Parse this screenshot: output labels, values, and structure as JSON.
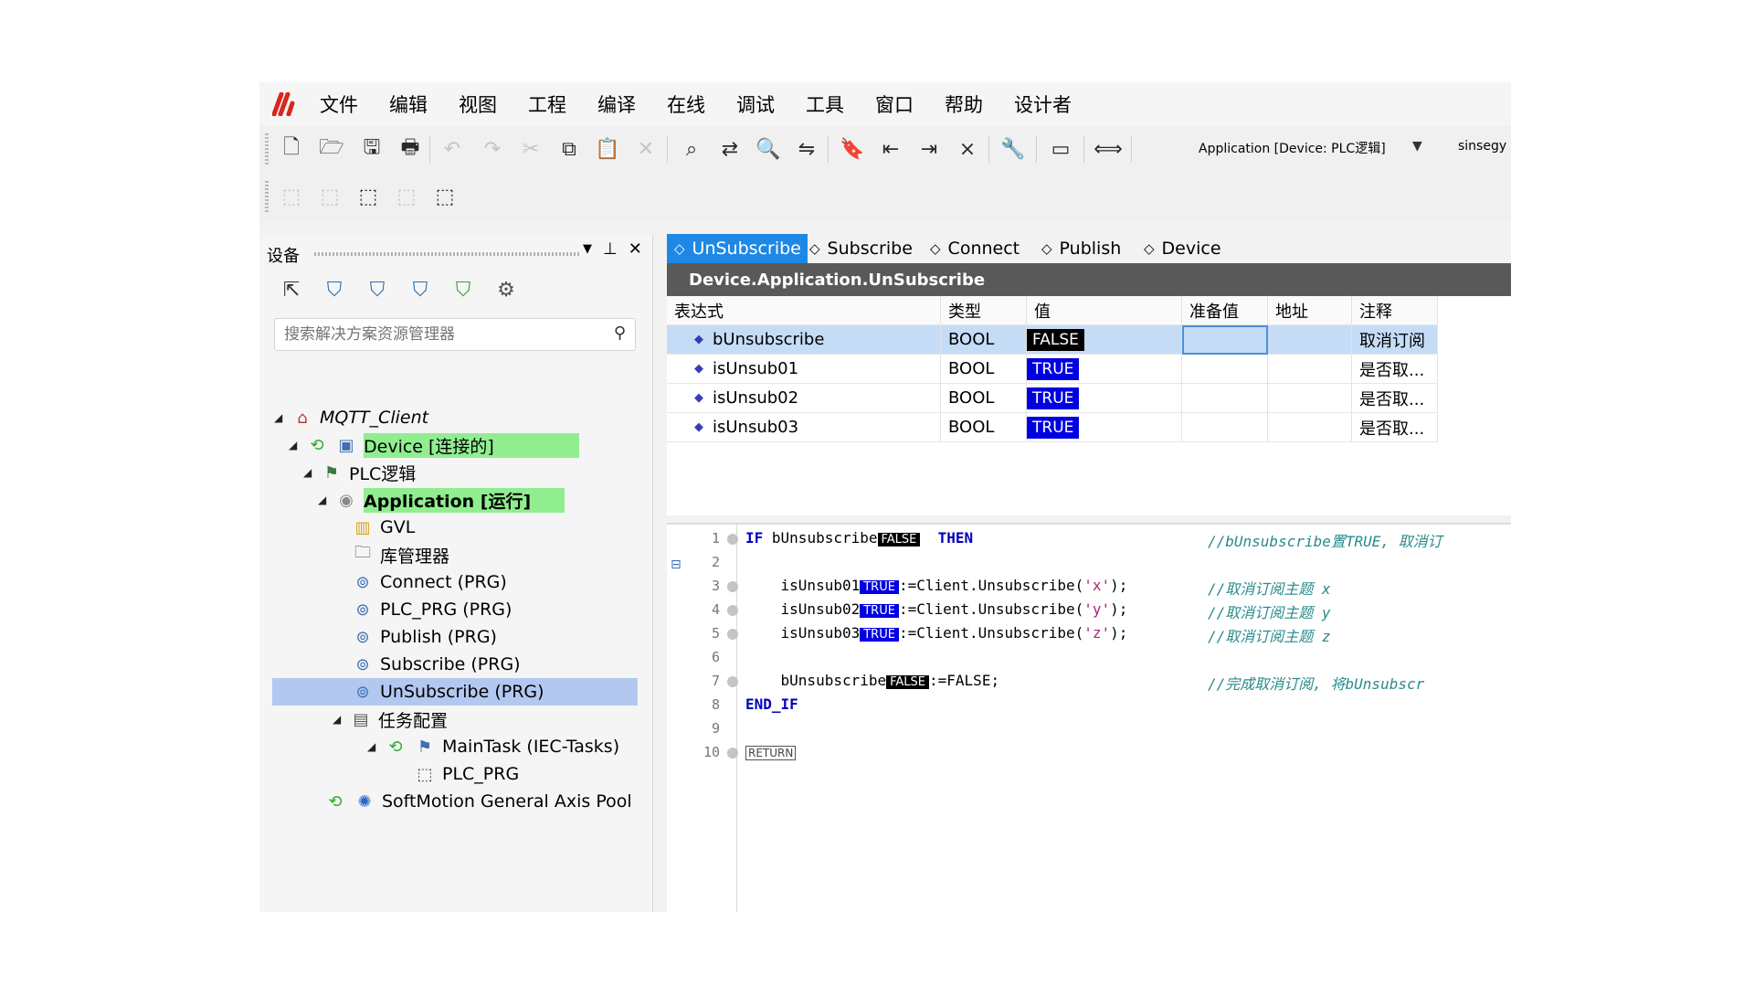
{
  "menu": [
    "文件",
    "编辑",
    "视图",
    "工程",
    "编译",
    "在线",
    "调试",
    "工具",
    "窗口",
    "帮助",
    "设计者"
  ],
  "toolbar": {
    "active_app": "Application [Device: PLC逻辑]",
    "user": "sinsegy"
  },
  "devices_panel": {
    "title": "设备",
    "search_placeholder": "搜索解决方案资源管理器",
    "tree": [
      {
        "label": "MQTT_Client"
      },
      {
        "label": "Device [连接的]"
      },
      {
        "label": "PLC逻辑"
      },
      {
        "label": "Application [运行]"
      },
      {
        "label": "GVL"
      },
      {
        "label": "库管理器"
      },
      {
        "label": "Connect (PRG)"
      },
      {
        "label": "PLC_PRG (PRG)"
      },
      {
        "label": "Publish (PRG)"
      },
      {
        "label": "Subscribe (PRG)"
      },
      {
        "label": "UnSubscribe (PRG)"
      },
      {
        "label": "任务配置"
      },
      {
        "label": "MainTask (IEC-Tasks)"
      },
      {
        "label": "PLC_PRG"
      },
      {
        "label": "SoftMotion General Axis Pool"
      }
    ]
  },
  "editor": {
    "tabs": [
      "UnSubscribe",
      "Subscribe",
      "Connect",
      "Publish",
      "Device"
    ],
    "path": "Device.Application.UnSubscribe",
    "watch": {
      "headers": [
        "表达式",
        "类型",
        "值",
        "准备值",
        "地址",
        "注释"
      ],
      "rows": [
        {
          "expr": "bUnsubscribe",
          "type": "BOOL",
          "value": "FALSE",
          "comment": "取消订阅"
        },
        {
          "expr": "isUnsub01",
          "type": "BOOL",
          "value": "TRUE",
          "comment": "是否取..."
        },
        {
          "expr": "isUnsub02",
          "type": "BOOL",
          "value": "TRUE",
          "comment": "是否取..."
        },
        {
          "expr": "isUnsub03",
          "type": "BOOL",
          "value": "TRUE",
          "comment": "是否取..."
        }
      ]
    },
    "code": {
      "line_numbers": [
        "1",
        "2",
        "3",
        "4",
        "5",
        "6",
        "7",
        "8",
        "9",
        "10"
      ],
      "kw_if": "IF",
      "kw_then": "THEN",
      "kw_endif": "END_IF",
      "var_bunsub": "bUnsubscribe",
      "var_unsub01": "isUnsub01",
      "var_unsub02": "isUnsub02",
      "var_unsub03": "isUnsub03",
      "val_true": "TRUE",
      "val_false": "FALSE",
      "call_prefix": ":=Client.Unsubscribe(",
      "arg_x": "'x'",
      "arg_y": "'y'",
      "arg_z": "'z'",
      "call_suffix": ");",
      "assign_false": ":=FALSE;",
      "return": "RETURN",
      "comment1": "//bUnsubscribe置TRUE, 取消订",
      "comment3": "//取消订阅主题 x",
      "comment4": "//取消订阅主题 y",
      "comment5": "//取消订阅主题 z",
      "comment7": "//完成取消订阅, 将bUnsubscr"
    }
  }
}
